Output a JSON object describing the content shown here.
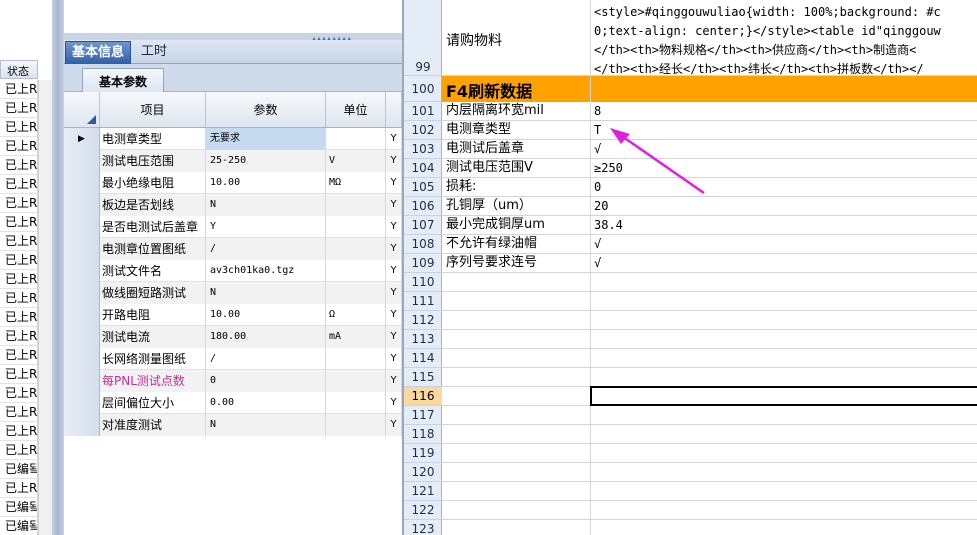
{
  "status_strip": {
    "header": "状态",
    "items": [
      "已上R",
      "已上R",
      "已上R",
      "已上R",
      "已上R",
      "已上R",
      "已上R",
      "已上R",
      "已上R",
      "已上R",
      "已上R",
      "已上R",
      "已上R",
      "已上R",
      "已上R",
      "已上R",
      "已上R",
      "已上R",
      "已上R",
      "已上R",
      "已编돸",
      "已上R",
      "已编돸",
      "已编돸"
    ]
  },
  "panel": {
    "tabs": [
      "基本信息",
      "工时"
    ],
    "active_tab": "基本信息",
    "subtab": "基本参数",
    "columns": {
      "name": "项目",
      "value": "参数",
      "unit": "单位"
    },
    "rows": [
      {
        "indicator": "▶",
        "name": "电测章类型",
        "value": "无要求",
        "unit": "",
        "y": "Y"
      },
      {
        "indicator": "",
        "name": "测试电压范围",
        "value": "25-250",
        "unit": "V",
        "y": "Y"
      },
      {
        "indicator": "",
        "name": "最小绝缘电阻",
        "value": "10.00",
        "unit": "MΩ",
        "y": "Y"
      },
      {
        "indicator": "",
        "name": "板边是否划线",
        "value": "N",
        "unit": "",
        "y": "Y"
      },
      {
        "indicator": "",
        "name": "是否电测试后盖章",
        "value": "Y",
        "unit": "",
        "y": "Y"
      },
      {
        "indicator": "",
        "name": "电测章位置图纸",
        "value": "/",
        "unit": "",
        "y": "Y"
      },
      {
        "indicator": "",
        "name": "测试文件名",
        "value": "av3ch01ka0.tgz",
        "unit": "",
        "y": "Y"
      },
      {
        "indicator": "",
        "name": "做线圈短路测试",
        "value": "N",
        "unit": "",
        "y": "Y"
      },
      {
        "indicator": "",
        "name": "开路电阻",
        "value": "10.00",
        "unit": "Ω",
        "y": "Y"
      },
      {
        "indicator": "",
        "name": "测试电流",
        "value": "180.00",
        "unit": "mA",
        "y": "Y"
      },
      {
        "indicator": "",
        "name": "长网络测量图纸",
        "value": "/",
        "unit": "",
        "y": "Y"
      },
      {
        "indicator": "",
        "name": "每PNL测试点数",
        "value": "0",
        "unit": "",
        "y": "Y"
      },
      {
        "indicator": "",
        "name": "层间偏位大小",
        "value": "0.00",
        "unit": "",
        "y": "Y"
      },
      {
        "indicator": "",
        "name": "对准度测试",
        "value": "N",
        "unit": "",
        "y": "Y"
      }
    ]
  },
  "sheet": {
    "row99": {
      "num": "99",
      "label": "请购物料",
      "code_lines": [
        "<style>#qinggouwuliao{width: 100%;background: #c",
        "0;text-align: center;}</style><table id\"qinggouw",
        "</th><th>物料规格</th><th>供应商</th><th>制造商<",
        "</th><th>经长</th><th>纬长</th><th>拼板数</th></"
      ]
    },
    "band": {
      "num": "100",
      "label": "F4刷新数据"
    },
    "rows": [
      {
        "num": "101",
        "label": "内层隔离环宽mil",
        "value": "8"
      },
      {
        "num": "102",
        "label": "电测章类型",
        "value": "T"
      },
      {
        "num": "103",
        "label": "电测试后盖章",
        "value": "√"
      },
      {
        "num": "104",
        "label": "测试电压范围V",
        "value": "≥250"
      },
      {
        "num": "105",
        "label": "损耗:",
        "value": "0"
      },
      {
        "num": "106",
        "label": "孔铜厚（um）",
        "value": "20"
      },
      {
        "num": "107",
        "label": "最小完成铜厚um",
        "value": "38.4"
      },
      {
        "num": "108",
        "label": "不允许有绿油帽",
        "value": "√"
      },
      {
        "num": "109",
        "label": "序列号要求连号",
        "value": "√"
      }
    ],
    "empty_rows": [
      "110",
      "111",
      "112",
      "113",
      "114",
      "115",
      "116",
      "117",
      "118",
      "119",
      "120",
      "121",
      "122",
      "123"
    ],
    "active_row": "116",
    "arrow_color": "#e020e0"
  }
}
